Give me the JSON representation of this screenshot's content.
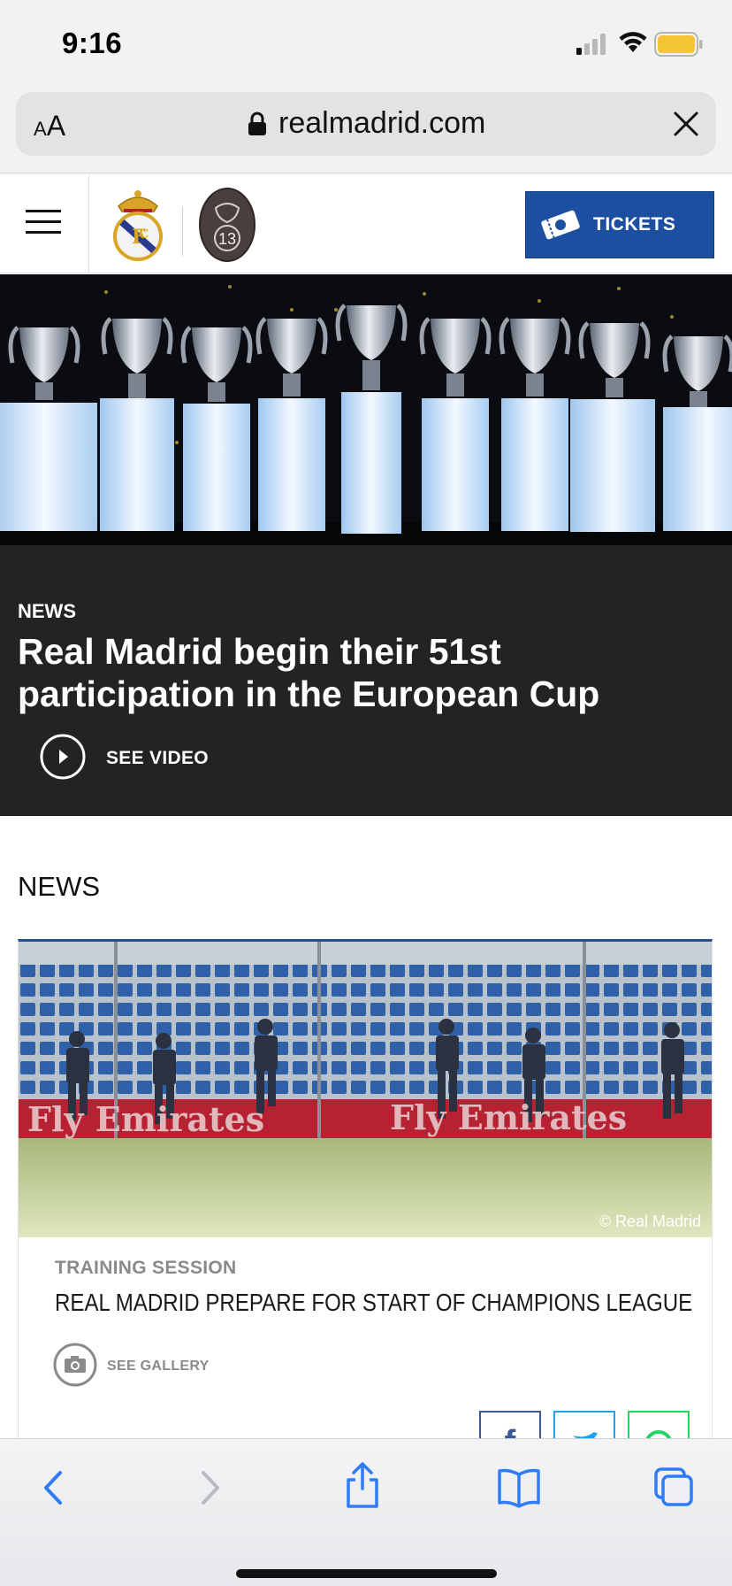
{
  "status_bar": {
    "time": "9:16",
    "battery_color": "#f5c433"
  },
  "browser": {
    "text_size_label_small": "A",
    "text_size_label_large": "A",
    "url": "realmadrid.com"
  },
  "site_header": {
    "badge_number": "13",
    "tickets_label": "TICKETS",
    "accent_color": "#1d4fa1"
  },
  "hero": {
    "category": "NEWS",
    "headline": "Real Madrid begin their 51st participation in the European Cup",
    "cta_label": "SEE VIDEO"
  },
  "news": {
    "section_title": "NEWS",
    "card": {
      "photo_watermark": "© Real Madrid",
      "photo_banner_text": "Fly Emirates",
      "kicker": "TRAINING SESSION",
      "title": "REAL MADRID PREPARE FOR START OF CHAMPIONS LEAGUE",
      "gallery_label": "SEE GALLERY",
      "share": [
        {
          "icon": "facebook-icon",
          "color": "#3b5998"
        },
        {
          "icon": "twitter-icon",
          "color": "#1da1f2"
        },
        {
          "icon": "whatsapp-icon",
          "color": "#25d366"
        }
      ]
    }
  },
  "toolbar": {
    "items": [
      "back-icon",
      "forward-icon",
      "share-icon",
      "bookmarks-icon",
      "tabs-icon"
    ]
  }
}
